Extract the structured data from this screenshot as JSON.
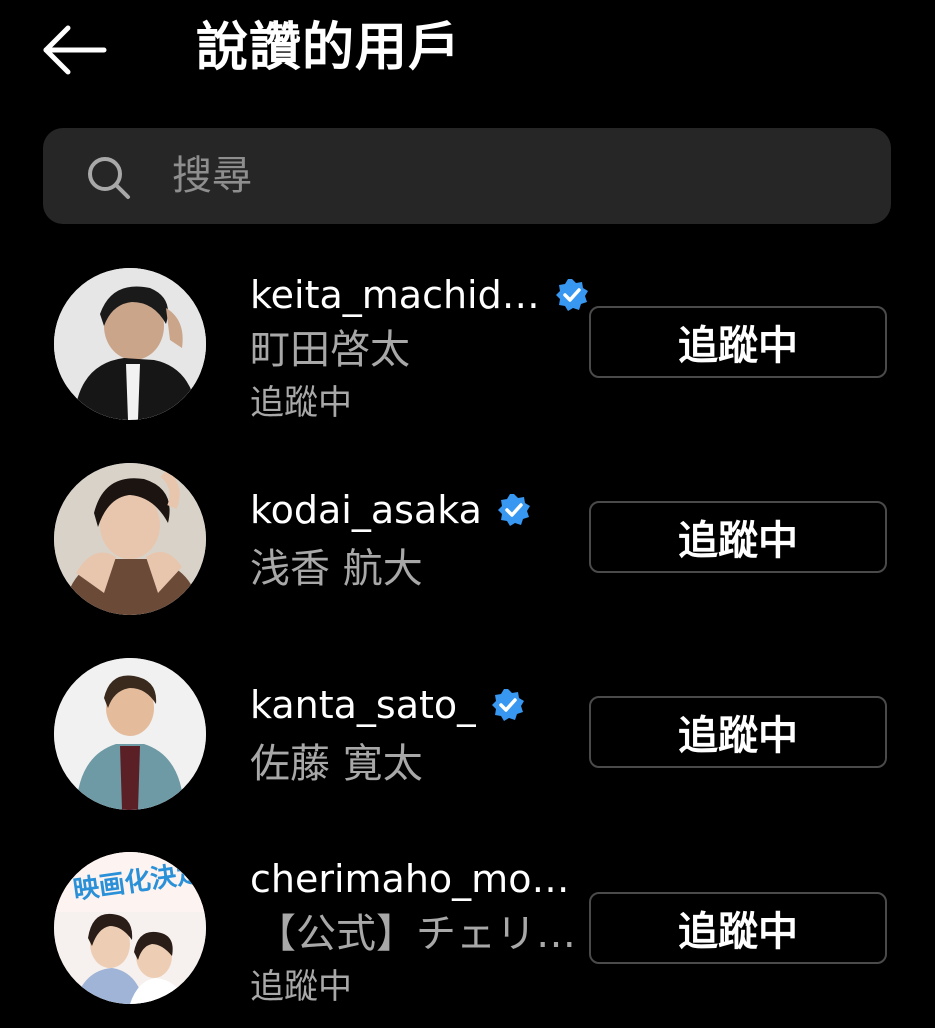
{
  "header": {
    "title": "說讚的用戶",
    "back_icon": "arrow-left-icon"
  },
  "search": {
    "placeholder": "搜尋",
    "value": "",
    "icon": "search-icon"
  },
  "colors": {
    "background": "#000000",
    "search_bg": "#262626",
    "secondary_text": "#a8a8a8",
    "verified_blue": "#3897f0",
    "button_border": "#4a4a4a"
  },
  "users": [
    {
      "username": "keita_machid…",
      "verified": true,
      "full_name": "町田啓太",
      "status": "追蹤中",
      "button_label": "追蹤中"
    },
    {
      "username": "kodai_asaka",
      "verified": true,
      "full_name": "浅香 航大",
      "status": "",
      "button_label": "追蹤中"
    },
    {
      "username": "kanta_sato_",
      "verified": true,
      "full_name": "佐藤 寛太",
      "status": "",
      "button_label": "追蹤中"
    },
    {
      "username": "cherimaho_mov…",
      "verified": false,
      "full_name": "【公式】チェリ…",
      "status": "追蹤中",
      "avatar_text": "映画化決定!",
      "button_label": "追蹤中"
    }
  ]
}
